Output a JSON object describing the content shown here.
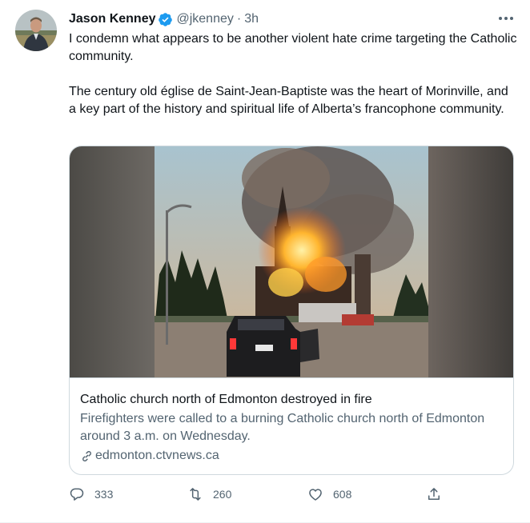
{
  "tweet": {
    "display_name": "Jason Kenney",
    "verified": true,
    "handle": "@jkenney",
    "separator": "·",
    "time": "3h",
    "paragraphs": [
      "I condemn what appears to be another violent hate crime targeting the Catholic community.",
      "The century old église de Saint-Jean-Baptiste was the heart of Morinville, and a key part of the history and spiritual life of Alberta’s francophone community."
    ],
    "card": {
      "title": "Catholic church north of Edmonton destroyed in fire",
      "description": "Firefighters were called to a burning Catholic church north of Edmonton around 3 a.m. on Wednesday.",
      "domain": "edmonton.ctvnews.ca"
    },
    "actions": {
      "replies": "333",
      "retweets": "260",
      "likes": "608"
    }
  },
  "colors": {
    "verified_blue": "#1d9bf0",
    "text_primary": "#0f1419",
    "text_secondary": "#536471",
    "border": "#cfd9de"
  },
  "icons": [
    "verified-badge-icon",
    "more-icon",
    "link-icon",
    "reply-icon",
    "retweet-icon",
    "like-icon",
    "share-icon"
  ]
}
